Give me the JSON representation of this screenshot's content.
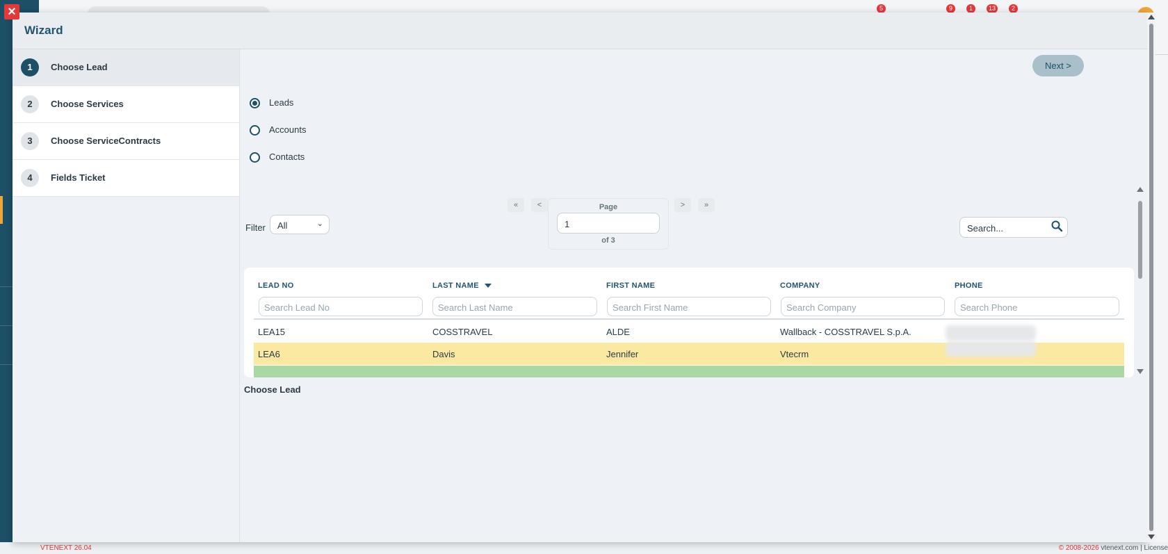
{
  "background": {
    "badges": [
      "5",
      "9",
      "1",
      "13",
      "2"
    ],
    "footer": {
      "version": "VTENEXT 26.04",
      "copyright": "© 2008-2026",
      "site": "vtenext.com",
      "separator": "|",
      "license": "License"
    }
  },
  "wizard": {
    "title": "Wizard",
    "close_icon": "close-icon",
    "steps": [
      {
        "num": "1",
        "label": "Choose Lead",
        "active": true
      },
      {
        "num": "2",
        "label": "Choose Services",
        "active": false
      },
      {
        "num": "3",
        "label": "Choose ServiceContracts",
        "active": false
      },
      {
        "num": "4",
        "label": "Fields Ticket",
        "active": false
      }
    ],
    "next_label": "Next >",
    "radios": [
      {
        "label": "Leads",
        "checked": true
      },
      {
        "label": "Accounts",
        "checked": false
      },
      {
        "label": "Contacts",
        "checked": false
      }
    ],
    "filter": {
      "label": "Filter",
      "selected": "All"
    },
    "pager": {
      "first": "«",
      "prev": "<",
      "next": ">",
      "last": "»",
      "page_label": "Page",
      "page_value": "1",
      "of_text": "of 3"
    },
    "search_placeholder": "Search...",
    "table": {
      "columns": [
        "LEAD NO",
        "LAST NAME",
        "FIRST NAME",
        "COMPANY",
        "PHONE"
      ],
      "search_placeholders": [
        "Search Lead No",
        "Search Last Name",
        "Search First Name",
        "Search Company",
        "Search Phone"
      ],
      "rows": [
        {
          "lead_no": "LEA15",
          "last_name": "COSSTRAVEL",
          "first_name": "ALDE",
          "company": "Wallback - COSSTRAVEL S.p.A.",
          "phone": ""
        },
        {
          "lead_no": "LEA6",
          "last_name": "Davis",
          "first_name": "Jennifer",
          "company": "Vtecrm",
          "phone": ""
        }
      ]
    },
    "caption": "Choose Lead"
  },
  "colors": {
    "primary": "#1d4f66",
    "selected_row": "#fbe9a1",
    "next_row": "#a9d8a4",
    "badge": "#e5383b"
  }
}
